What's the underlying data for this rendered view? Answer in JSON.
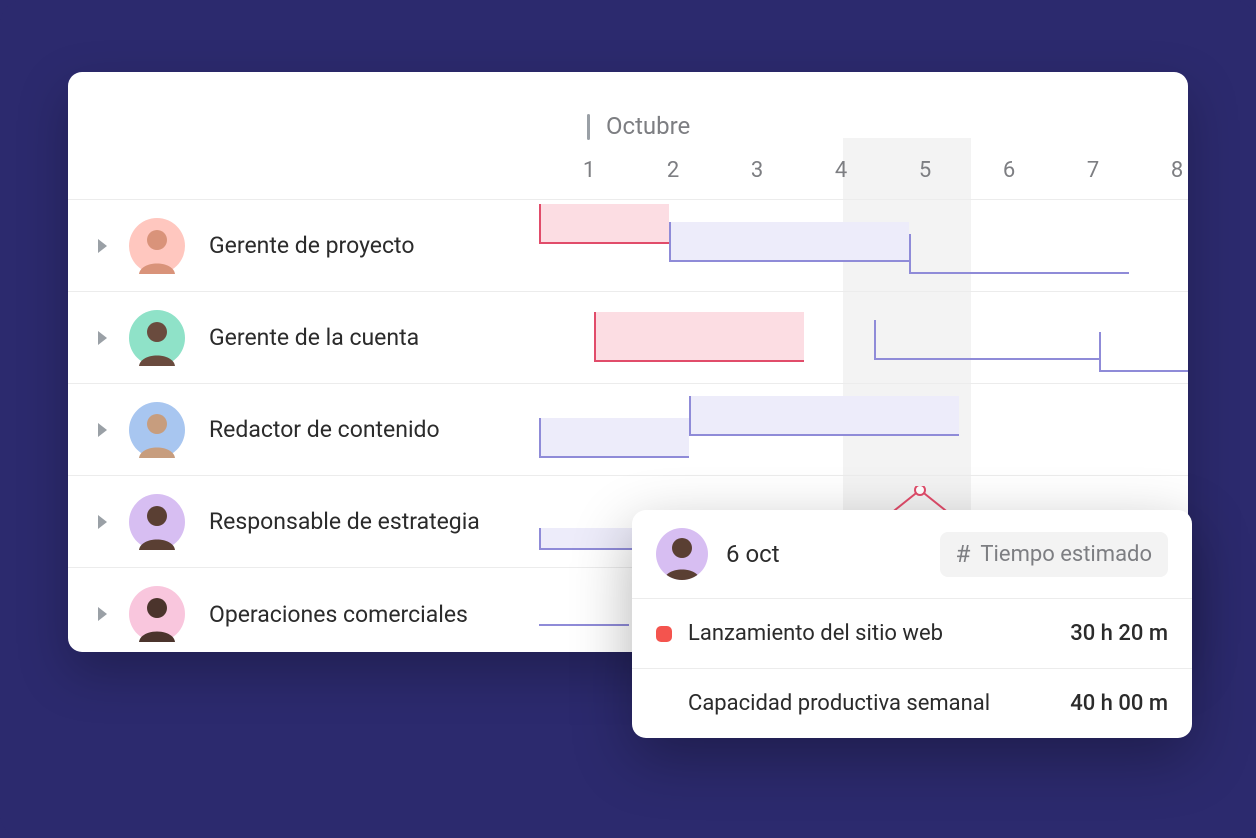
{
  "header": {
    "month": "Octubre",
    "days": [
      "1",
      "2",
      "3",
      "4",
      "5",
      "6",
      "7",
      "8"
    ]
  },
  "roles": [
    {
      "label": "Gerente de proyecto",
      "avatar_bg": "#ffc7bf"
    },
    {
      "label": "Gerente de la cuenta",
      "avatar_bg": "#8fe2c8"
    },
    {
      "label": "Redactor de contenido",
      "avatar_bg": "#a8c6f0"
    },
    {
      "label": "Responsable de estrategia",
      "avatar_bg": "#d7bef2"
    },
    {
      "label": "Operaciones comerciales",
      "avatar_bg": "#f9c6dd"
    }
  ],
  "popup": {
    "date": "6 oct",
    "badge": "Tiempo estimado",
    "task_label": "Lanzamiento del sitio web",
    "task_value": "30 h 20 m",
    "capacity_label": "Capacidad productiva semanal",
    "capacity_value": "40 h 00 m"
  }
}
